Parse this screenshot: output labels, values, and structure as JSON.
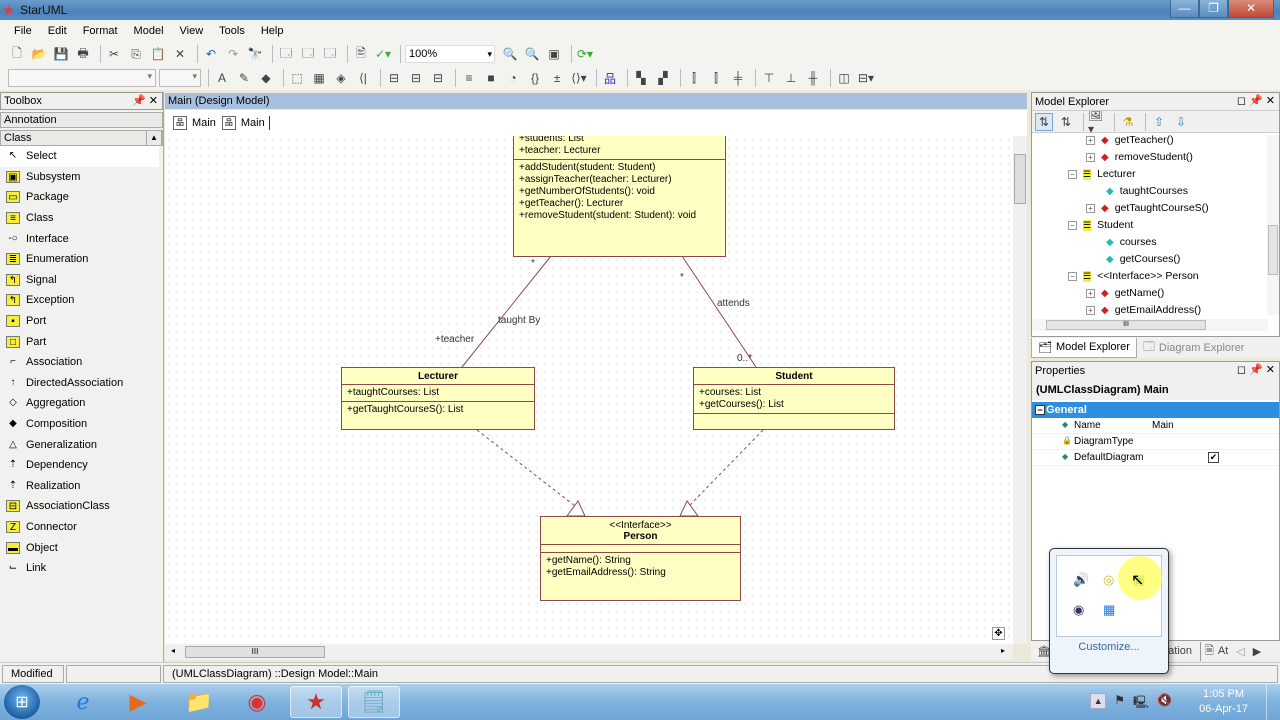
{
  "app": {
    "title": "StarUML"
  },
  "window_controls": {
    "minimize": "—",
    "restore": "❐",
    "close": "✕"
  },
  "menu": [
    "File",
    "Edit",
    "Format",
    "Model",
    "View",
    "Tools",
    "Help"
  ],
  "toolbar": {
    "zoom": "100%"
  },
  "toolbox": {
    "title": "Toolbox",
    "groups": {
      "annotation": "Annotation",
      "class": "Class"
    },
    "items": [
      {
        "label": "Select",
        "icon": "↖"
      },
      {
        "label": "Subsystem",
        "icon": "▣"
      },
      {
        "label": "Package",
        "icon": "▭"
      },
      {
        "label": "Class",
        "icon": "≡"
      },
      {
        "label": "Interface",
        "icon": "-○"
      },
      {
        "label": "Enumeration",
        "icon": "≣"
      },
      {
        "label": "Signal",
        "icon": "↰"
      },
      {
        "label": "Exception",
        "icon": "↰"
      },
      {
        "label": "Port",
        "icon": "▪"
      },
      {
        "label": "Part",
        "icon": "□"
      },
      {
        "label": "Association",
        "icon": "⌐"
      },
      {
        "label": "DirectedAssociation",
        "icon": "↑"
      },
      {
        "label": "Aggregation",
        "icon": "◇"
      },
      {
        "label": "Composition",
        "icon": "◆"
      },
      {
        "label": "Generalization",
        "icon": "△"
      },
      {
        "label": "Dependency",
        "icon": "⇡"
      },
      {
        "label": "Realization",
        "icon": "⇡"
      },
      {
        "label": "AssociationClass",
        "icon": "⊟"
      },
      {
        "label": "Connector",
        "icon": "Z"
      },
      {
        "label": "Object",
        "icon": "▬"
      },
      {
        "label": "Link",
        "icon": "⌙"
      }
    ]
  },
  "diagram": {
    "title": "Main (Design Model)",
    "tabs": [
      "Main",
      "Main"
    ],
    "classes": {
      "course": {
        "attributes": [
          "+students: List",
          "+teacher: Lecturer"
        ],
        "operations": [
          "+addStudent(student: Student)",
          "+assignTeacher(teacher: Lecturer)",
          "+getNumberOfStudents(): void",
          "+getTeacher(): Lecturer",
          "+removeStudent(student: Student): void"
        ]
      },
      "lecturer": {
        "name": "Lecturer",
        "attributes": [
          "+taughtCourses: List"
        ],
        "operations": [
          "+getTaughtCourseS(): List"
        ]
      },
      "student": {
        "name": "Student",
        "attributes": [
          "+courses: List",
          "+getCourses(): List"
        ],
        "operations": []
      },
      "person": {
        "stereotype": "<<Interface>>",
        "name": "Person",
        "operations": [
          "+getName(): String",
          "+getEmailAddress(): String"
        ]
      }
    },
    "labels": {
      "mult_left": "*",
      "mult_right": "*",
      "taught_by": "taught By",
      "teacher_role": "+teacher",
      "attends": "attends",
      "student_mult": "0..*"
    }
  },
  "model_explorer": {
    "title": "Model Explorer",
    "nodes": [
      {
        "label": "getTeacher()",
        "type": "operation"
      },
      {
        "label": "removeStudent()",
        "type": "operation"
      },
      {
        "label": "Lecturer",
        "type": "class"
      },
      {
        "label": "taughtCourses",
        "type": "attribute"
      },
      {
        "label": "getTaughtCourseS()",
        "type": "operation"
      },
      {
        "label": "Student",
        "type": "class"
      },
      {
        "label": "courses",
        "type": "attribute"
      },
      {
        "label": "getCourses()",
        "type": "attribute"
      },
      {
        "label": "<<Interface>> Person",
        "type": "class"
      },
      {
        "label": "getName()",
        "type": "operation"
      },
      {
        "label": "getEmailAddress()",
        "type": "operation"
      }
    ],
    "tabs": [
      "Model Explorer",
      "Diagram Explorer"
    ]
  },
  "properties": {
    "title": "Properties",
    "object": "(UMLClassDiagram) Main",
    "group": "General",
    "rows": [
      {
        "key": "Name",
        "value": "Main"
      },
      {
        "key": "DiagramType",
        "value": ""
      },
      {
        "key": "DefaultDiagram",
        "value": "✔"
      }
    ]
  },
  "bottom_tabs": {
    "partial": "ntation",
    "attach": "At"
  },
  "statusbar": {
    "state": "Modified",
    "path": "(UMLClassDiagram) ::Design Model::Main"
  },
  "tray_popup": {
    "customize": "Customize..."
  },
  "taskbar": {
    "time": "1:05 PM",
    "date": "06-Apr-17"
  }
}
